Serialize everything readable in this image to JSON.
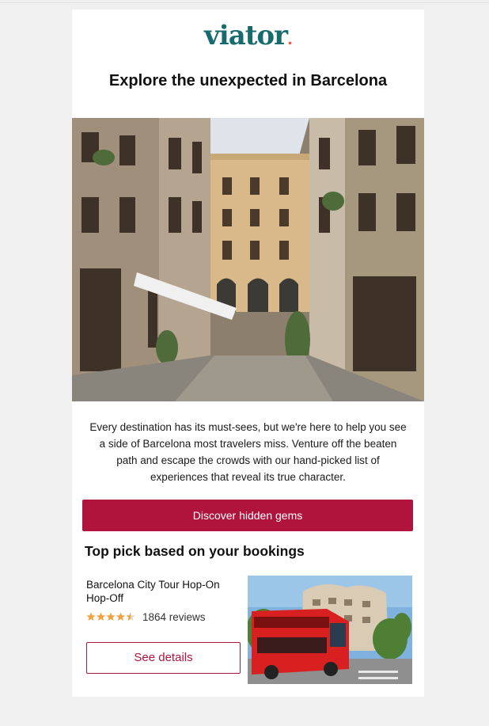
{
  "brand": {
    "logo_text": "viator",
    "logo_color": "#186b6d",
    "accent_color": "#b0143c"
  },
  "email": {
    "headline": "Explore the unexpected in Barcelona",
    "intro": "Every destination has its must-sees, but we're here to help you see a side of Barcelona most travelers miss. Venture off the beaten path and escape the crowds with our hand-picked list of experiences that reveal its true character.",
    "cta_label": "Discover hidden gems"
  },
  "top_pick": {
    "section_title": "Top pick based on your bookings",
    "tour_name": "Barcelona City Tour Hop-On Hop-Off",
    "rating": 4.5,
    "reviews_label": "1864 reviews",
    "details_label": "See details"
  },
  "icons": {
    "rating_star": "star-icon"
  }
}
